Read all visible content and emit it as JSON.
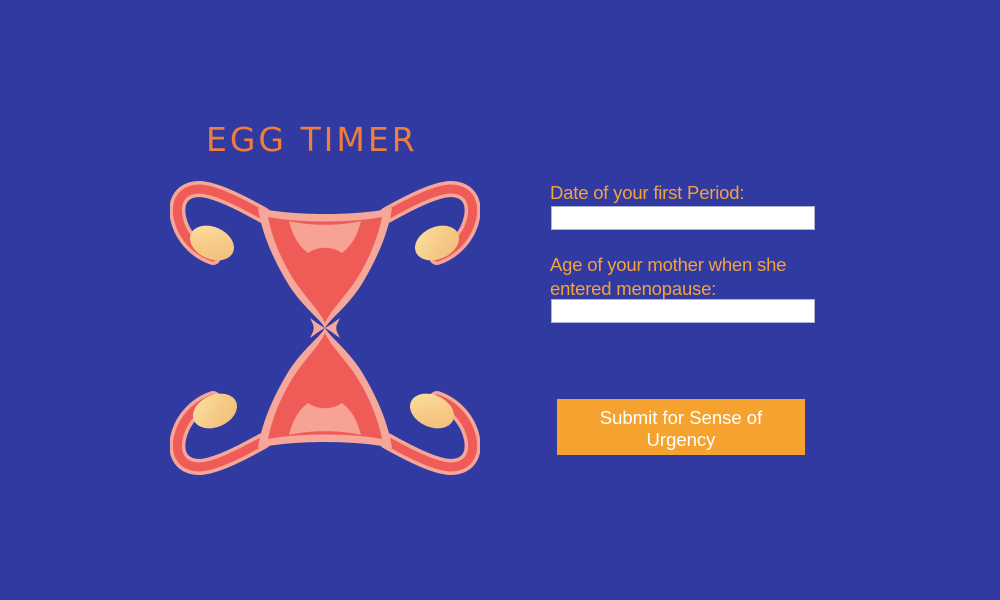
{
  "logo": {
    "title": "EGG TIMER"
  },
  "form": {
    "first_period_label": "Date of your first Period:",
    "first_period_value": "",
    "mother_menopause_label_line_1": "Age of your mother when she",
    "mother_menopause_label_line_2": "entered menopause:",
    "mother_menopause_value": "",
    "submit_label": "Submit for Sense of Urgency"
  },
  "colors": {
    "background": "#303aa1",
    "logo_text": "#ef7d3b",
    "form_labels": "#f5a23b",
    "submit_button": "#f5a22f",
    "button_text": "#ffffff",
    "uterus_red": "#ef5c58",
    "uterus_outline": "#f5a799",
    "egg_yellow": "#f6ca86"
  },
  "icons": {
    "logo_illustration": "uterus-hourglass-icon"
  }
}
